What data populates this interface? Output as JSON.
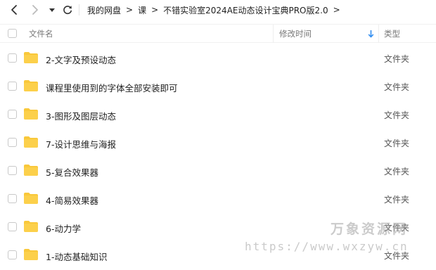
{
  "breadcrumb": {
    "items": [
      {
        "label": "我的网盘"
      },
      {
        "label": "课"
      },
      {
        "label": "不错实验室2024AE动态设计宝典PRO版2.0"
      }
    ]
  },
  "columns": {
    "name": "文件名",
    "modified": "修改时间",
    "type": "类型"
  },
  "files": [
    {
      "name": "2-文字及预设动态",
      "type": "文件夹"
    },
    {
      "name": "课程里使用到的字体全部安装即可",
      "type": "文件夹"
    },
    {
      "name": "3-图形及图层动态",
      "type": "文件夹"
    },
    {
      "name": "7-设计思维与海报",
      "type": "文件夹"
    },
    {
      "name": "5-复合效果器",
      "type": "文件夹"
    },
    {
      "name": "4-简易效果器",
      "type": "文件夹"
    },
    {
      "name": "6-动力学",
      "type": "文件夹"
    },
    {
      "name": "1-动态基础知识",
      "type": "文件夹"
    }
  ],
  "watermark": {
    "text": "万象资源网",
    "url": "https://www.wxzyw.cn"
  },
  "colors": {
    "folder": "#F9C83B",
    "sort_arrow": "#2F8CF0"
  },
  "icons": [
    "back-icon",
    "forward-icon",
    "dropdown-icon",
    "refresh-icon",
    "chevron-right-icon",
    "sort-down-icon",
    "folder-icon"
  ]
}
